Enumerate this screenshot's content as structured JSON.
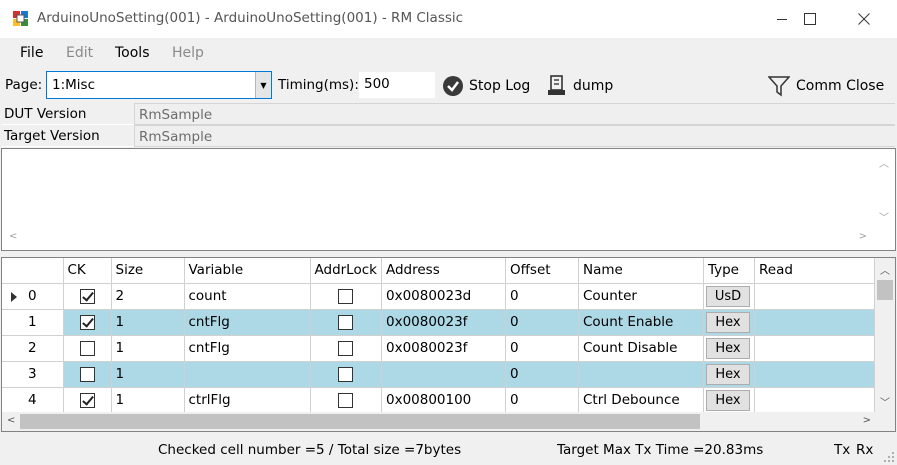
{
  "window": {
    "title": "ArduinoUnoSetting(001) - ArduinoUnoSetting(001) - RM Classic"
  },
  "menu": {
    "file": "File",
    "edit": "Edit",
    "tools": "Tools",
    "help": "Help"
  },
  "toolbar": {
    "page_label": "Page:",
    "page_value": "1:Misc",
    "timing_label": "Timing(ms):",
    "timing_value": "500",
    "stop_log": "Stop Log",
    "dump": "dump",
    "comm_close": "Comm Close"
  },
  "info": {
    "dut_label": "DUT Version",
    "dut_value": "RmSample",
    "target_label": "Target Version",
    "target_value": "RmSample"
  },
  "grid": {
    "headers": [
      "CK",
      "Size",
      "Variable",
      "AddrLock",
      "Address",
      "Offset",
      "Name",
      "Type",
      "Read"
    ],
    "rows": [
      {
        "index": "0",
        "ck": true,
        "size": "2",
        "variable": "count",
        "addrlock": false,
        "address": "0x0080023d",
        "offset": "0",
        "name": "Counter",
        "type": "UsD",
        "read": "",
        "current": true
      },
      {
        "index": "1",
        "ck": true,
        "size": "1",
        "variable": "cntFlg",
        "addrlock": false,
        "address": "0x0080023f",
        "offset": "0",
        "name": "Count Enable",
        "type": "Hex",
        "read": ""
      },
      {
        "index": "2",
        "ck": false,
        "size": "1",
        "variable": "cntFlg",
        "addrlock": false,
        "address": "0x0080023f",
        "offset": "0",
        "name": "Count Disable",
        "type": "Hex",
        "read": ""
      },
      {
        "index": "3",
        "ck": false,
        "size": "1",
        "variable": "",
        "addrlock": false,
        "address": "",
        "offset": "0",
        "name": "",
        "type": "Hex",
        "read": ""
      },
      {
        "index": "4",
        "ck": true,
        "size": "1",
        "variable": "ctrlFlg",
        "addrlock": false,
        "address": "0x00800100",
        "offset": "0",
        "name": "Ctrl Debounce",
        "type": "Hex",
        "read": ""
      }
    ]
  },
  "status": {
    "checked": "Checked cell number =5 / Total size =7bytes",
    "tx_time": "Target Max Tx Time =20.83ms",
    "tx": "Tx",
    "rx": "Rx"
  },
  "colors": {
    "alt_row": "#add8e6",
    "accent": "#0078d7"
  }
}
